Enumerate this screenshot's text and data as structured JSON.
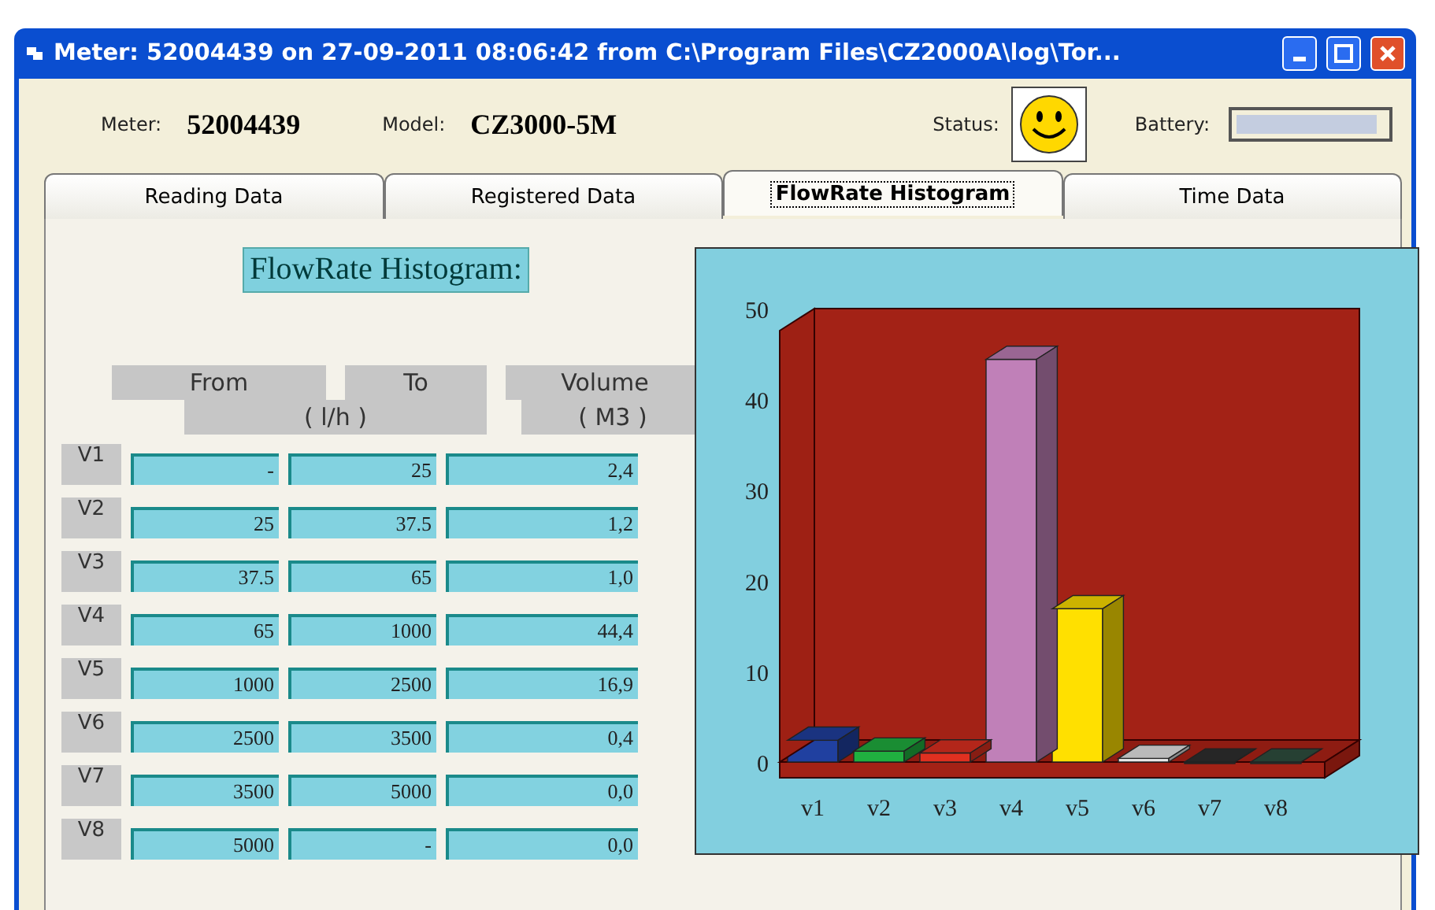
{
  "window": {
    "title": "Meter: 52004439 on 27-09-2011 08:06:42 from C:\\Program Files\\CZ2000A\\log\\Tor..."
  },
  "info": {
    "meter_label": "Meter:",
    "meter": "52004439",
    "model_label": "Model:",
    "model": "CZ3000-5M",
    "status_label": "Status:",
    "battery_label": "Battery:",
    "battery": {
      "level": 0.95
    }
  },
  "tabs": [
    {
      "label": "Reading Data",
      "selected": false
    },
    {
      "label": "Registered Data",
      "selected": false
    },
    {
      "label": "FlowRate Histogram",
      "selected": true
    },
    {
      "label": "Time Data",
      "selected": false
    }
  ],
  "heading": "FlowRate Histogram:",
  "table": {
    "columns": [
      "From",
      "To",
      "Volume"
    ],
    "units": [
      "( l/h )",
      "( M3 )"
    ],
    "rows": [
      {
        "label": "V1",
        "from": "-",
        "to": "25",
        "volume": "2,4"
      },
      {
        "label": "V2",
        "from": "25",
        "to": "37.5",
        "volume": "1,2"
      },
      {
        "label": "V3",
        "from": "37.5",
        "to": "65",
        "volume": "1,0"
      },
      {
        "label": "V4",
        "from": "65",
        "to": "1000",
        "volume": "44,4"
      },
      {
        "label": "V5",
        "from": "1000",
        "to": "2500",
        "volume": "16,9"
      },
      {
        "label": "V6",
        "from": "2500",
        "to": "3500",
        "volume": "0,4"
      },
      {
        "label": "V7",
        "from": "3500",
        "to": "5000",
        "volume": "0,0"
      },
      {
        "label": "V8",
        "from": "5000",
        "to": "-",
        "volume": "0,0"
      }
    ]
  },
  "chart": {
    "chart_data": {
      "type": "bar",
      "categories": [
        "v1",
        "v2",
        "v3",
        "v4",
        "v5",
        "v6",
        "v7",
        "v8"
      ],
      "series": [
        {
          "values": [
            2.4,
            1.2,
            1.0,
            44.4,
            16.9,
            0.4,
            0.0,
            0.0
          ]
        }
      ],
      "colors": [
        "#2040a0",
        "#20b040",
        "#e03020",
        "#c080b8",
        "#ffe000",
        "#e8e8e8",
        "#303030",
        "#305040"
      ],
      "ylim": [
        0,
        50
      ],
      "yticks": [
        0,
        10,
        20,
        30,
        40,
        50
      ]
    }
  }
}
